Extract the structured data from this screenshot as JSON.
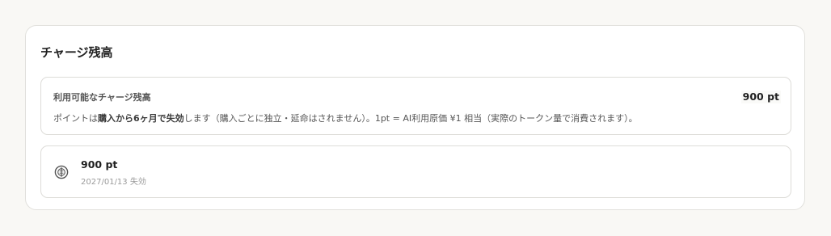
{
  "section": {
    "title": "チャージ残高"
  },
  "balance": {
    "label": "利用可能なチャージ残高",
    "amount": "900 pt",
    "description": {
      "part1": "ポイントは",
      "bold1": "購入から6ヶ月で失効",
      "part2": "します（購入ごとに独立・延命はされません）。1pt = AI利用原価 ¥1 相当（実際のトークン量で消費されます）。"
    }
  },
  "lots": [
    {
      "icon": "coin-yen-icon",
      "amount": "900 pt",
      "expiry": "2027/01/13 失効"
    }
  ]
}
